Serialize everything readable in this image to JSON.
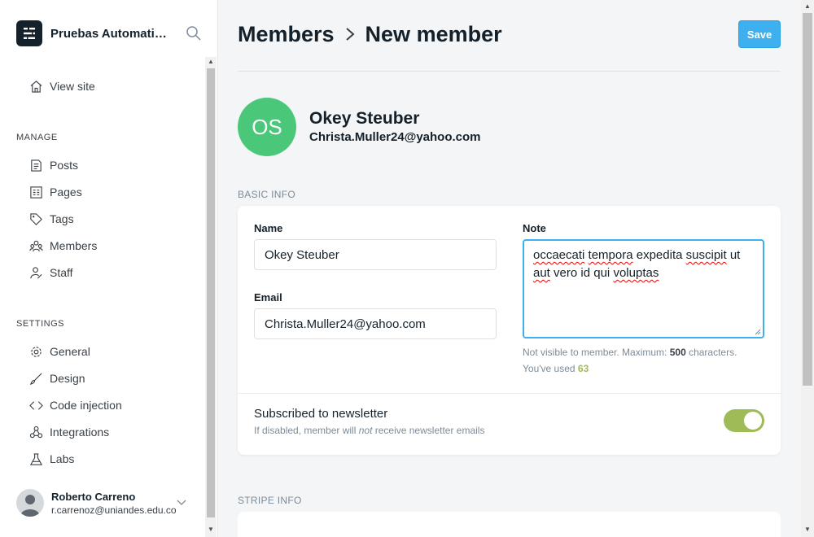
{
  "sidebar": {
    "site_title": "Pruebas Automatizadas",
    "view_site": "View site",
    "manage_label": "MANAGE",
    "manage_items": [
      {
        "label": "Posts",
        "icon": "posts-icon"
      },
      {
        "label": "Pages",
        "icon": "pages-icon"
      },
      {
        "label": "Tags",
        "icon": "tag-icon"
      },
      {
        "label": "Members",
        "icon": "members-icon"
      },
      {
        "label": "Staff",
        "icon": "staff-icon"
      }
    ],
    "settings_label": "SETTINGS",
    "settings_items": [
      {
        "label": "General",
        "icon": "gear-icon"
      },
      {
        "label": "Design",
        "icon": "brush-icon"
      },
      {
        "label": "Code injection",
        "icon": "code-icon"
      },
      {
        "label": "Integrations",
        "icon": "integrations-icon"
      },
      {
        "label": "Labs",
        "icon": "flask-icon"
      }
    ],
    "user": {
      "name": "Roberto Carreno",
      "email": "r.carrenoz@uniandes.edu.co"
    }
  },
  "header": {
    "breadcrumb_parent": "Members",
    "breadcrumb_current": "New member",
    "save_label": "Save"
  },
  "member": {
    "initials": "OS",
    "name": "Okey Steuber",
    "email": "Christa.Muller24@yahoo.com"
  },
  "basic_info": {
    "section_title": "BASIC INFO",
    "name_label": "Name",
    "name_value": "Okey Steuber",
    "email_label": "Email",
    "email_value": "Christa.Muller24@yahoo.com",
    "note_label": "Note",
    "note_value": "occaecati tempora expedita suscipit ut aut vero id qui voluptas",
    "note_help_prefix": "Not visible to member. Maximum: ",
    "note_max": "500",
    "note_help_suffix": " characters.",
    "note_used_prefix": "You've used ",
    "note_used": "63",
    "newsletter_label": "Subscribed to newsletter",
    "newsletter_desc_prefix": "If disabled, member will ",
    "newsletter_desc_em": "not",
    "newsletter_desc_suffix": " receive newsletter emails",
    "newsletter_enabled": true
  },
  "stripe_info": {
    "section_title": "STRIPE INFO"
  },
  "colors": {
    "accent": "#3eb0ef",
    "avatar": "#4bc77a",
    "toggle_on": "#9fbb58"
  }
}
